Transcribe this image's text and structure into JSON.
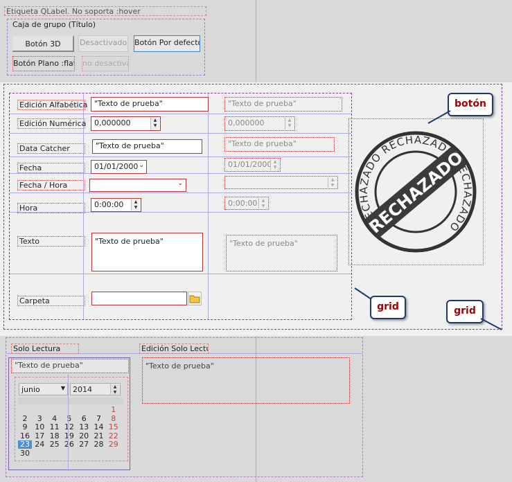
{
  "top": {
    "qlabel": "Etiqueta QLabel. No soporta :hover",
    "groupbox_title": "Caja de grupo (Título)",
    "btn_3d": "Botón 3D",
    "btn_disabled": "Desactivado",
    "btn_default": "Botón Por defecto",
    "btn_flat": "Botón Plano :flat",
    "btn_flat_disabled": "no desactiva"
  },
  "form": {
    "labels": {
      "alpha": "Edición Alfabética",
      "numeric": "Edición Numérica",
      "catcher": "Data Catcher",
      "date": "Fecha",
      "datetime": "Fecha / Hora",
      "time": "Hora",
      "text": "Texto",
      "folder": "Carpeta"
    },
    "values": {
      "alpha": "\"Texto de prueba\"",
      "numeric": "0,000000",
      "catcher": "\"Texto de prueba\"",
      "date": "01/01/2000",
      "time": "0:00:00",
      "text": "\"Texto de prueba\""
    },
    "disabled_values": {
      "alpha": "\"Texto de prueba\"",
      "numeric": "0,000000",
      "catcher": "\"Texto de prueba\"",
      "date": "01/01/2000",
      "time": "0:00:00",
      "text": "\"Texto de prueba\""
    }
  },
  "stamp": {
    "ring_text": "RECHAZADO RECHAZADO RECHAZADO",
    "center_text": "RECHAZADO"
  },
  "callouts": {
    "boton": "botón",
    "grid1": "grid",
    "grid2": "grid"
  },
  "bottom": {
    "readonly_label": "Solo Lectura",
    "readonly_edit_label": "Edición Solo Lectur",
    "readonly_value": "\"Texto de prueba\"",
    "readonly_text_value": "\"Texto de prueba\"",
    "calendar": {
      "month": "junio",
      "year": "2014",
      "weeks": [
        [
          "",
          "",
          "",
          "",
          "",
          "",
          "1"
        ],
        [
          "2",
          "3",
          "4",
          "5",
          "6",
          "7",
          "8"
        ],
        [
          "9",
          "10",
          "11",
          "12",
          "13",
          "14",
          "15"
        ],
        [
          "16",
          "17",
          "18",
          "19",
          "20",
          "21",
          "22"
        ],
        [
          "23",
          "24",
          "25",
          "26",
          "27",
          "28",
          "29"
        ],
        [
          "30",
          "",
          "",
          "",
          "",
          "",
          ""
        ]
      ],
      "selected": "23",
      "weekend_color": "#d04040",
      "selected_bg": "#4a90d9"
    }
  }
}
